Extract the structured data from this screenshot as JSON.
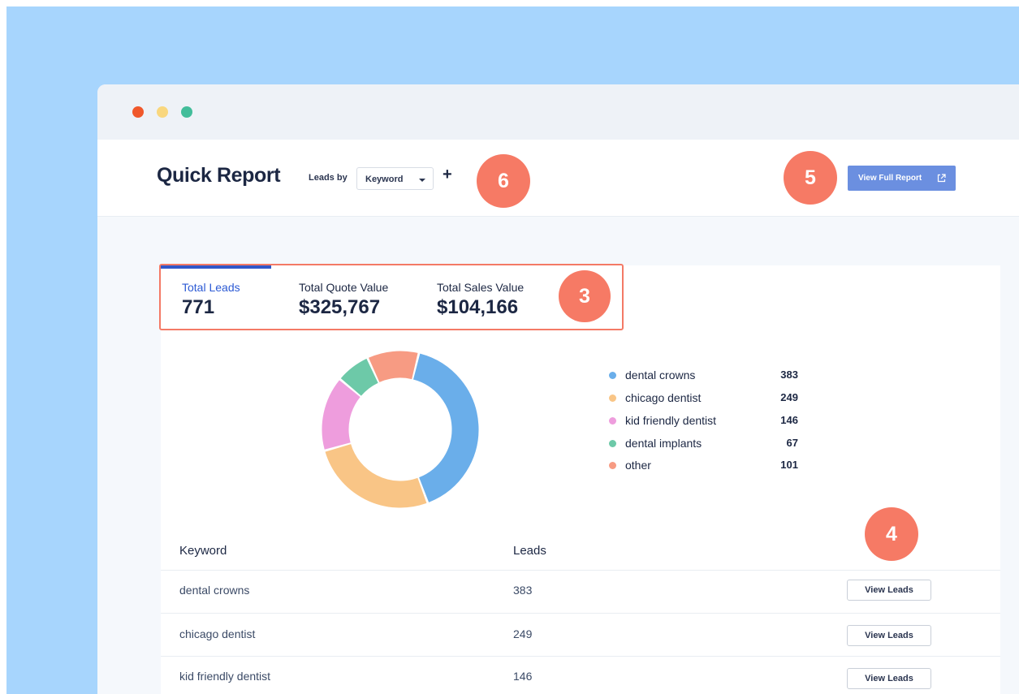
{
  "header": {
    "title": "Quick Report",
    "leads_by_label": "Leads by",
    "group_select": {
      "value": "Keyword"
    },
    "add_icon": "plus-icon",
    "view_full_report": "View Full Report",
    "external_link_icon": "external-link-icon"
  },
  "badges": {
    "six": "6",
    "five": "5",
    "three": "3",
    "four": "4"
  },
  "metrics": [
    {
      "label": "Total Leads",
      "value": "771",
      "active": true
    },
    {
      "label": "Total Quote Value",
      "value": "$325,767"
    },
    {
      "label": "Total Sales Value",
      "value": "$104,166"
    }
  ],
  "chart_data": {
    "type": "pie",
    "donut": true,
    "categories": [
      "dental crowns",
      "chicago dentist",
      "kid friendly dentist",
      "dental implants",
      "other"
    ],
    "values": [
      383,
      249,
      146,
      67,
      101
    ],
    "colors": [
      "#6aaeea",
      "#f9c586",
      "#ee9ddd",
      "#6dc9a8",
      "#f79b83"
    ]
  },
  "legend": [
    {
      "label": "dental crowns",
      "value": "383",
      "color": "#6aaeea"
    },
    {
      "label": "chicago dentist",
      "value": "249",
      "color": "#f9c586"
    },
    {
      "label": "kid friendly dentist",
      "value": "146",
      "color": "#ee9ddd"
    },
    {
      "label": "dental implants",
      "value": "67",
      "color": "#6dc9a8"
    },
    {
      "label": "other",
      "value": "101",
      "color": "#f79b83"
    }
  ],
  "table": {
    "columns": [
      "Keyword",
      "Leads"
    ],
    "rows": [
      {
        "keyword": "dental crowns",
        "leads": "383",
        "action": "View Leads"
      },
      {
        "keyword": "chicago dentist",
        "leads": "249",
        "action": "View Leads"
      },
      {
        "keyword": "kid friendly dentist",
        "leads": "146",
        "action": "View Leads"
      }
    ]
  }
}
